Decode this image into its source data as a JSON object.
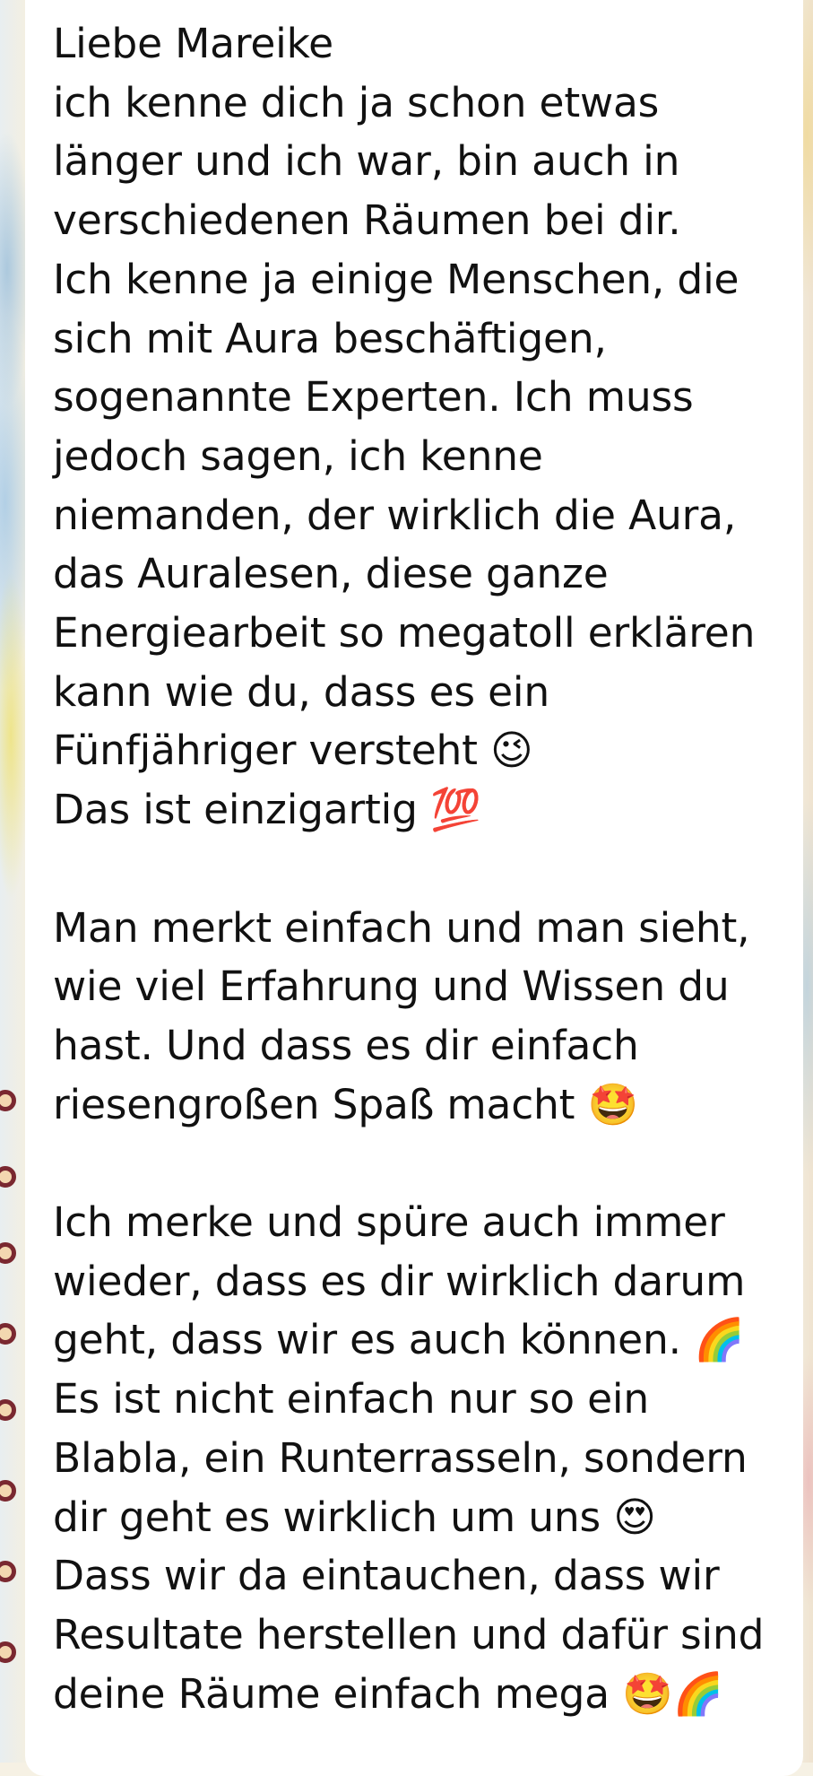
{
  "chat": {
    "message": {
      "text": "Liebe Mareike\nich kenne dich ja schon etwas\nlänger und ich war, bin auch in\nverschiedenen Räumen bei dir.\nIch kenne ja einige Menschen, die\nsich mit Aura beschäftigen,\nsogenannte Experten. Ich muss\njedoch sagen, ich kenne\nniemanden, der wirklich die Aura,\ndas Auralesen, diese ganze\nEnergiearbeit so megatoll erklären\nkann wie du, dass es ein\nFünfjähriger versteht 😉\nDas ist einzigartig 💯\n\nMan merkt einfach und man sieht,\nwie viel Erfahrung und Wissen du\nhast. Und dass es dir einfach\nriesengroßen Spaß macht 🤩\n\nIch merke und spüre auch immer\nwieder, dass es dir wirklich darum\ngeht, dass wir es auch können. 🌈\nEs ist nicht einfach nur so ein\nBlabla, ein Runterrasseln, sondern\ndir geht es wirklich um uns 😍\nDass wir da eintauchen, dass wir\nResultate herstellen und dafür sind\ndeine Räume einfach mega 🤩🌈"
    }
  }
}
